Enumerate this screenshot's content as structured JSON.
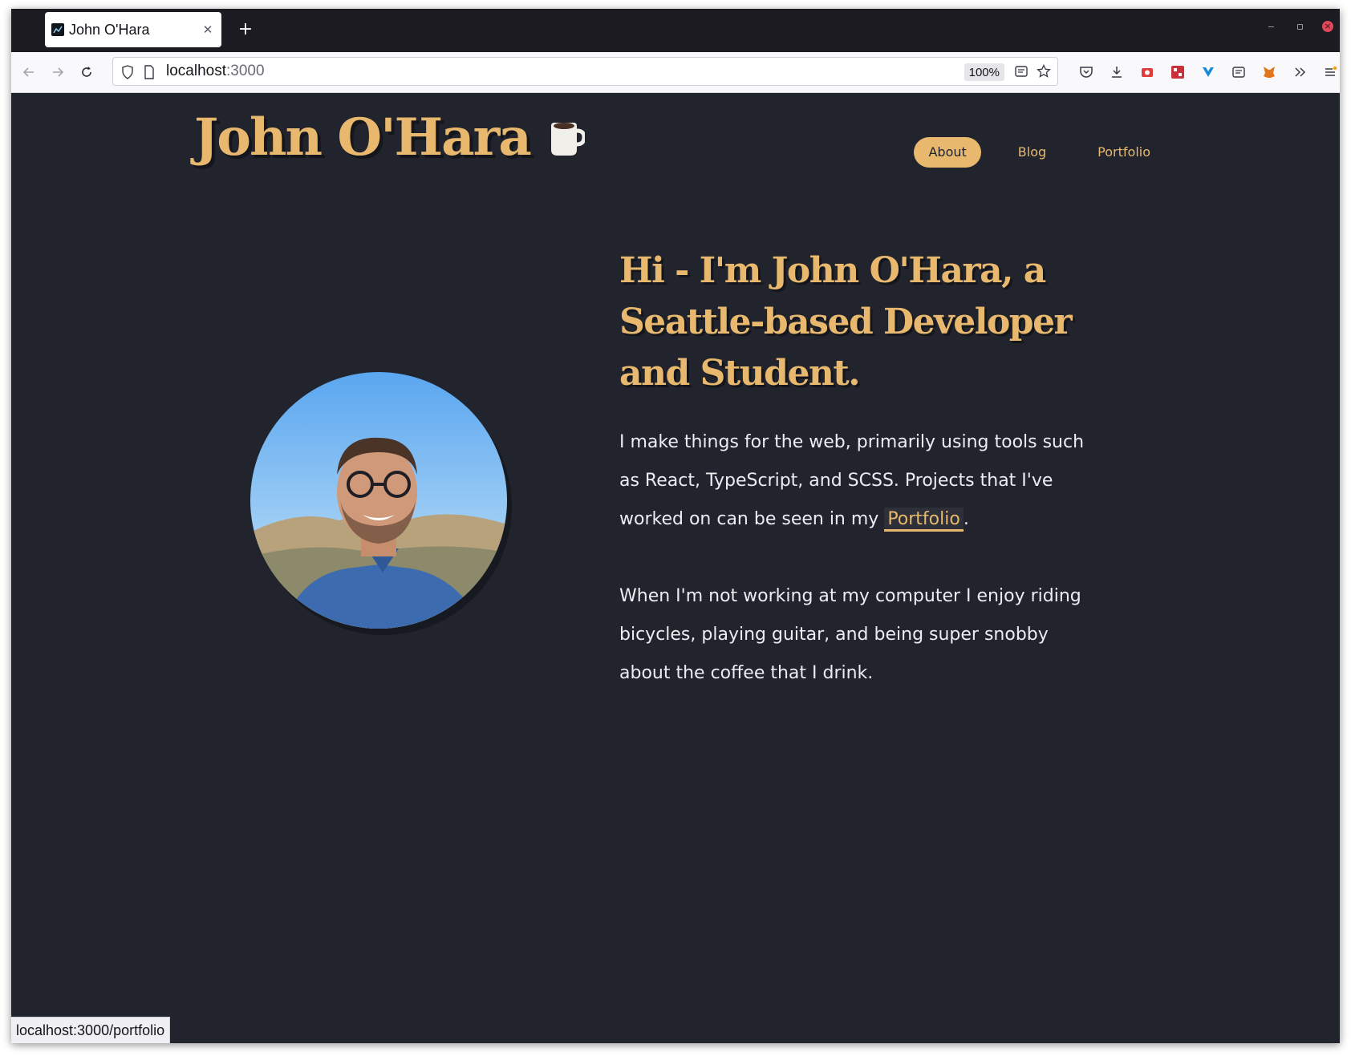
{
  "browser": {
    "tab_title": "John O'Hara",
    "url_host": "localhost",
    "url_port": ":3000",
    "zoom": "100%",
    "status_url": "localhost:3000/portfolio"
  },
  "site": {
    "logo": "John O'Hara",
    "logo_icon": "coffee-mug-icon",
    "nav": [
      {
        "label": "About",
        "active": true
      },
      {
        "label": "Blog",
        "active": false
      },
      {
        "label": "Portfolio",
        "active": false
      }
    ]
  },
  "about": {
    "headline": "Hi - I'm John O'Hara, a Seattle-based Developer and Student.",
    "para1_before": "I make things for the web, primarily using tools such as React, TypeScript, and SCSS. Projects that I've worked on can be seen in my ",
    "para1_link": "Portfolio",
    "para1_after": ".",
    "para2": "When I'm not working at my computer I enjoy riding bicycles, playing guitar, and being super snobby about the coffee that I drink."
  },
  "colors": {
    "accent": "#e8b86e",
    "background": "#21242d",
    "text": "#ecedf0"
  }
}
